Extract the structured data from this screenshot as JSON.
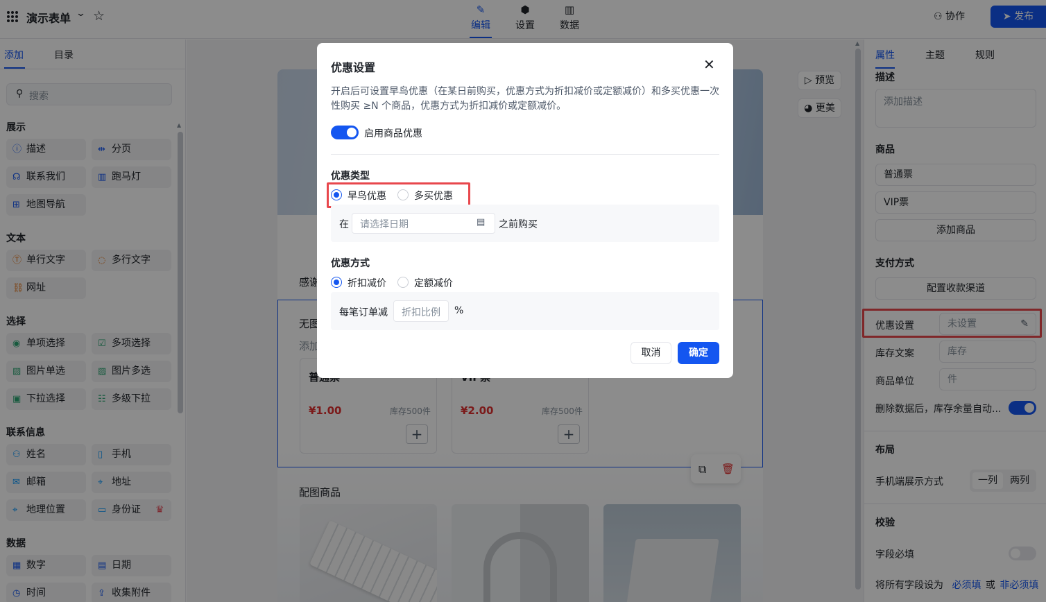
{
  "header": {
    "title": "演示表单",
    "tabs": [
      {
        "label": "编辑",
        "icon": "pencil-icon",
        "active": true
      },
      {
        "label": "设置",
        "icon": "settings-hexagon-icon",
        "active": false
      },
      {
        "label": "数据",
        "icon": "bar-chart-icon",
        "active": false
      }
    ],
    "collab_label": "协作",
    "publish_label": "发布"
  },
  "left_panel": {
    "tabs": [
      "添加",
      "目录"
    ],
    "search_placeholder": "搜索",
    "sections": {
      "display": "展示",
      "text": "文本",
      "choice": "选择",
      "contact": "联系信息",
      "data": "数据"
    },
    "items": {
      "description": "描述",
      "pagination": "分页",
      "contact_us": "联系我们",
      "marquee": "跑马灯",
      "map_nav": "地图导航",
      "single_line": "单行文字",
      "multi_line": "多行文字",
      "url": "网址",
      "single_choice": "单项选择",
      "multi_choice": "多项选择",
      "image_single": "图片单选",
      "image_multi": "图片多选",
      "dropdown": "下拉选择",
      "cascade": "多级下拉",
      "name": "姓名",
      "mobile": "手机",
      "email": "邮箱",
      "address": "地址",
      "location": "地理位置",
      "id_card": "身份证",
      "number": "数字",
      "date": "日期",
      "time": "时间",
      "attachment": "收集附件"
    }
  },
  "canvas": {
    "preview_label": "预览",
    "beautify_label": "更美",
    "thanks_text": "感谢",
    "block_title": "无图",
    "block_desc": "添加",
    "products": [
      {
        "name": "普通票",
        "price": "¥1.00",
        "stock": "库存500件"
      },
      {
        "name": "VIP票",
        "price": "¥2.00",
        "stock": "库存500件"
      }
    ],
    "pic_section_title": "配图商品"
  },
  "right_panel": {
    "tabs": [
      "属性",
      "主题",
      "规则"
    ],
    "desc_label": "描述",
    "desc_placeholder": "添加描述",
    "product_label": "商品",
    "product_items": [
      "普通票",
      "VIP票"
    ],
    "add_product_label": "添加商品",
    "payment_label": "支付方式",
    "payment_button": "配置收款渠道",
    "discount_label": "优惠设置",
    "discount_value": "未设置",
    "stock_text_label": "库存文案",
    "stock_text_placeholder": "库存",
    "unit_label": "商品单位",
    "unit_placeholder": "件",
    "auto_restore_label": "删除数据后，库存余量自动...",
    "layout_label": "布局",
    "mobile_display_label": "手机端展示方式",
    "seg_one": "一列",
    "seg_two": "两列",
    "validate_label": "校验",
    "required_label": "字段必填",
    "set_all_prefix": "将所有字段设为",
    "set_all_required": "必须填",
    "set_all_or": "或",
    "set_all_optional": "非必须填",
    "auto_restore_on": true,
    "required_on": false
  },
  "modal": {
    "title": "优惠设置",
    "description": "开启后可设置早鸟优惠（在某日前购买，优惠方式为折扣减价或定额减价）和多买优惠一次性购买 ≥N 个商品，优惠方式为折扣减价或定额减价。",
    "enable_label": "启用商品优惠",
    "enable_on": true,
    "type_label": "优惠类型",
    "type_options": [
      "早鸟优惠",
      "多买优惠"
    ],
    "type_selected": "早鸟优惠",
    "date_prefix": "在",
    "date_placeholder": "请选择日期",
    "date_suffix": "之前购买",
    "method_label": "优惠方式",
    "method_options": [
      "折扣减价",
      "定额减价"
    ],
    "method_selected": "折扣减价",
    "per_order_label": "每笔订单减",
    "ratio_placeholder": "折扣比例",
    "percent_sign": "%",
    "cancel_label": "取消",
    "confirm_label": "确定"
  },
  "colors": {
    "accent": "#1456f0",
    "highlight": "#e8474c",
    "price": "#e03131"
  }
}
